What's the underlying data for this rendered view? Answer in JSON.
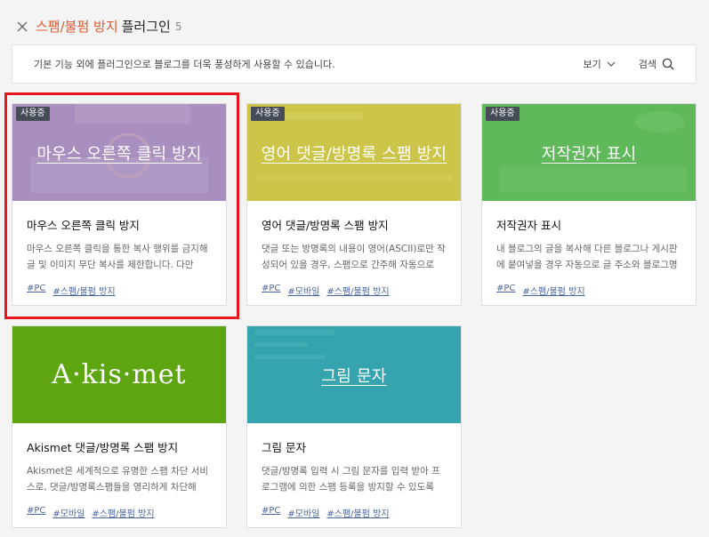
{
  "header": {
    "title_accent": "스팸/불펌 방지",
    "title_rest": "플러그인",
    "count": "5"
  },
  "info": {
    "text": "기본 기능 외에 플러그인으로 블로그를 더욱 풍성하게 사용할 수 있습니다.",
    "view_label": "보기",
    "search_label": "검색"
  },
  "cards": [
    {
      "badge": "사용중",
      "thumb_text": "마우스 오른쪽 클릭 방지",
      "thumb_color": "#a98fbf",
      "title": "마우스 오른쪽 클릭 방지",
      "desc": "마우스 오른쪽 클릭을 통한 복사 행위를 금지해 글 및 이미지 무단 복사를 제한합니다. 다만 일…",
      "tags": [
        "#PC",
        "#스팸/불펌 방지"
      ]
    },
    {
      "badge": "사용중",
      "thumb_text": "영어 댓글/방명록 스팸 방지",
      "thumb_color": "#cdc54a",
      "title": "영어 댓글/방명록 스팸 방지",
      "desc": "댓글 또는 방명록의 내용이 영어(ASCII)로만 작성되어 있을 경우, 스팸으로 간주해 자동으로 차…",
      "tags": [
        "#PC",
        "#모바일",
        "#스팸/불펌 방지"
      ]
    },
    {
      "badge": "사용중",
      "thumb_text": "저작권자 표시",
      "thumb_color": "#5fb85a",
      "title": "저작권자 표시",
      "desc": "내 블로그의 글을 복사해 다른 블로그나 게시판에 붙여넣을 경우 자동으로 글 주소와 블로그명에…",
      "tags": [
        "#PC",
        "#스팸/불펌 방지"
      ]
    },
    {
      "badge": "",
      "thumb_text": "A·kis·met",
      "thumb_color": "#5ea611",
      "title": "Akismet 댓글/방명록 스팸 방지",
      "desc": "Akismet은 세계적으로 유명한 스팸 차단 서비스로, 댓글/방명록스팸들을 영리하게 차단해 쾌…",
      "tags": [
        "#PC",
        "#모바일",
        "#스팸/불펌 방지"
      ]
    },
    {
      "badge": "",
      "thumb_text": "그림 문자",
      "thumb_color": "#35a4ae",
      "title": "그림 문자",
      "desc": "댓글/방명록 입력 시 그림 문자를 입력 받아 프로그램에 의한 스팸 등록을 방지할 수 있도록 도…",
      "tags": [
        "#PC",
        "#모바일",
        "#스팸/불펌 방지"
      ]
    }
  ],
  "colors": {
    "accent": "#e05a2e",
    "badge_bg": "#464c57",
    "tag_link": "#4a66a0",
    "highlight_border": "#e8151d"
  }
}
